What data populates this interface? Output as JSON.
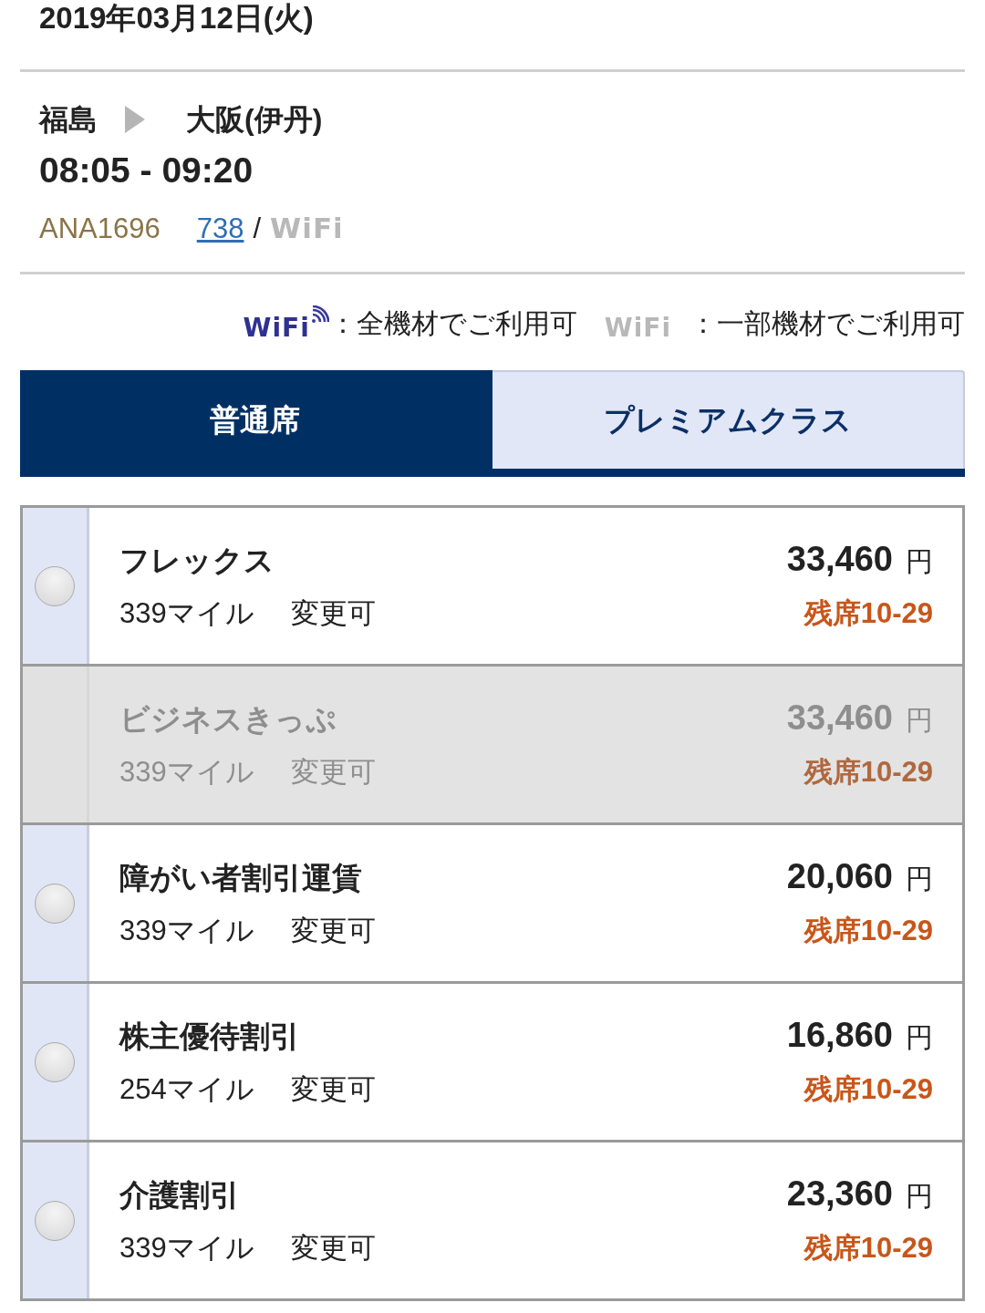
{
  "date": "2019年03月12日(火)",
  "flight": {
    "origin": "福島",
    "destination": "大阪(伊丹)",
    "time": "08:05 - 09:20",
    "number": "ANA1696",
    "aircraft": "738",
    "separator": "/",
    "wifi": {
      "label": "WiFi",
      "kind": "partial"
    }
  },
  "wifi_legend": [
    {
      "label": "WiFi",
      "kind": "all",
      "text": "：全機材でご利用可"
    },
    {
      "label": "WiFi",
      "kind": "partial",
      "text": "：一部機材でご利用可"
    }
  ],
  "tabs": [
    {
      "label": "普通席",
      "selected": true
    },
    {
      "label": "プレミアムクラス",
      "selected": false
    }
  ],
  "fares": [
    {
      "name": "フレックス",
      "miles": "339マイル",
      "change": "変更可",
      "price": "33,460",
      "currency": "円",
      "seats": "残席10-29",
      "disabled": false,
      "selected": false
    },
    {
      "name": "ビジネスきっぷ",
      "miles": "339マイル",
      "change": "変更可",
      "price": "33,460",
      "currency": "円",
      "seats": "残席10-29",
      "disabled": true
    },
    {
      "name": "障がい者割引運賃",
      "miles": "339マイル",
      "change": "変更可",
      "price": "20,060",
      "currency": "円",
      "seats": "残席10-29",
      "disabled": false,
      "selected": false
    },
    {
      "name": "株主優待割引",
      "miles": "254マイル",
      "change": "変更可",
      "price": "16,860",
      "currency": "円",
      "seats": "残席10-29",
      "disabled": false,
      "selected": false
    },
    {
      "name": "介護割引",
      "miles": "339マイル",
      "change": "変更可",
      "price": "23,360",
      "currency": "円",
      "seats": "残席10-29",
      "disabled": false,
      "selected": false
    }
  ]
}
